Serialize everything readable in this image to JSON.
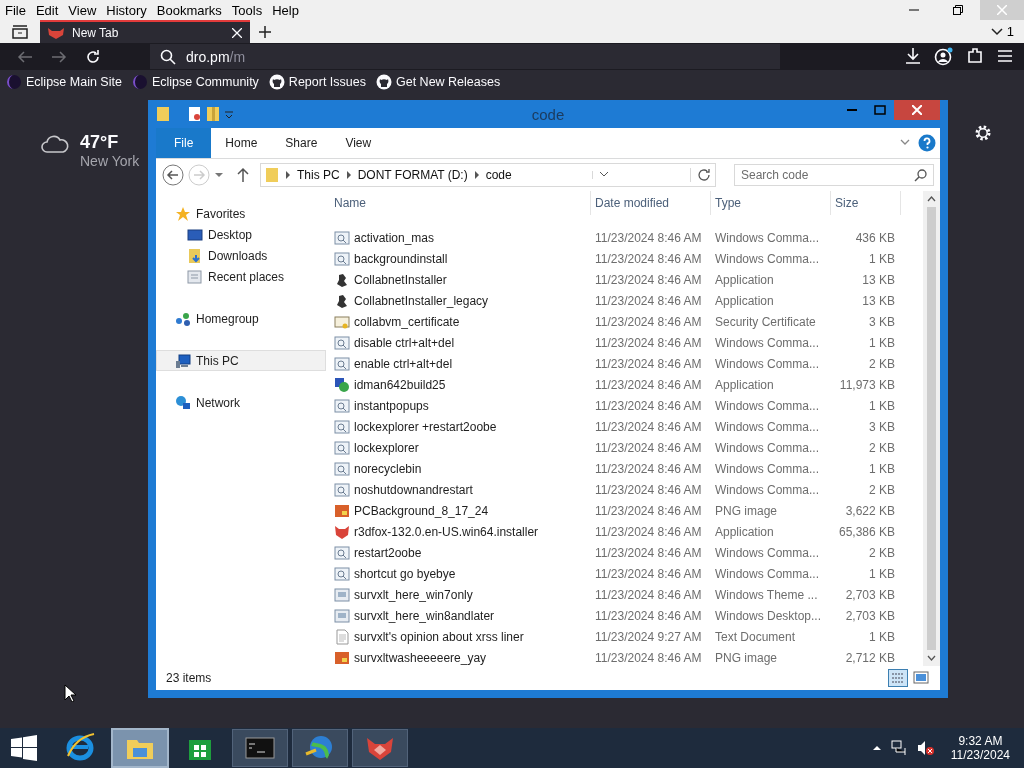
{
  "browser": {
    "menu": [
      "File",
      "Edit",
      "View",
      "History",
      "Bookmarks",
      "Tools",
      "Help"
    ],
    "tabs": [
      {
        "title": "New Tab",
        "selected": true
      }
    ],
    "window_count": "1",
    "url": {
      "host": "dro.pm",
      "path": "/m"
    },
    "bookmarks": [
      {
        "label": "Eclipse Main Site",
        "kind": "eclipse"
      },
      {
        "label": "Eclipse Community",
        "kind": "eclipse"
      },
      {
        "label": "Report Issues",
        "kind": "github"
      },
      {
        "label": "Get New Releases",
        "kind": "github"
      }
    ]
  },
  "weather": {
    "temperature": "47°F",
    "city": "New York"
  },
  "explorer": {
    "title": "code",
    "ribbon_tabs": [
      {
        "label": "File",
        "kind": "menu"
      },
      {
        "label": "Home",
        "kind": "tab"
      },
      {
        "label": "Share",
        "kind": "tab"
      },
      {
        "label": "View",
        "kind": "tab"
      }
    ],
    "breadcrumb": [
      "This PC",
      "DONT FORMAT (D:)",
      "code"
    ],
    "search": {
      "placeholder": "Search code"
    },
    "nav": [
      {
        "label": "Favorites",
        "kind": "star",
        "selected": false,
        "children": [
          {
            "label": "Desktop",
            "kind": "desktop",
            "selected": false
          },
          {
            "label": "Downloads",
            "kind": "downloads",
            "selected": false
          },
          {
            "label": "Recent places",
            "kind": "recent",
            "selected": false
          }
        ]
      },
      {
        "label": "Homegroup",
        "kind": "homegroup",
        "selected": false
      },
      {
        "label": "This PC",
        "kind": "pc",
        "selected": true
      },
      {
        "label": "Network",
        "kind": "network",
        "selected": false
      }
    ],
    "columns": [
      "Name",
      "Date modified",
      "Type",
      "Size"
    ],
    "rows": [
      {
        "name": "activation_mas",
        "date": "11/23/2024 8:46 AM",
        "type": "Windows Comma...",
        "size": "436 KB",
        "kind": "script"
      },
      {
        "name": "backgroundinstall",
        "date": "11/23/2024 8:46 AM",
        "type": "Windows Comma...",
        "size": "1 KB",
        "kind": "script"
      },
      {
        "name": "CollabnetInstaller",
        "date": "11/23/2024 8:46 AM",
        "type": "Application",
        "size": "13 KB",
        "kind": "app"
      },
      {
        "name": "CollabnetInstaller_legacy",
        "date": "11/23/2024 8:46 AM",
        "type": "Application",
        "size": "13 KB",
        "kind": "app"
      },
      {
        "name": "collabvm_certificate",
        "date": "11/23/2024 8:46 AM",
        "type": "Security Certificate",
        "size": "3 KB",
        "kind": "certificate"
      },
      {
        "name": "disable ctrl+alt+del",
        "date": "11/23/2024 8:46 AM",
        "type": "Windows Comma...",
        "size": "1 KB",
        "kind": "script"
      },
      {
        "name": "enable ctrl+alt+del",
        "date": "11/23/2024 8:46 AM",
        "type": "Windows Comma...",
        "size": "2 KB",
        "kind": "script"
      },
      {
        "name": "idman642build25",
        "date": "11/23/2024 8:46 AM",
        "type": "Application",
        "size": "11,973 KB",
        "kind": "globe"
      },
      {
        "name": "instantpopups",
        "date": "11/23/2024 8:46 AM",
        "type": "Windows Comma...",
        "size": "1 KB",
        "kind": "script"
      },
      {
        "name": "lockexplorer +restart2oobe",
        "date": "11/23/2024 8:46 AM",
        "type": "Windows Comma...",
        "size": "3 KB",
        "kind": "script"
      },
      {
        "name": "lockexplorer",
        "date": "11/23/2024 8:46 AM",
        "type": "Windows Comma...",
        "size": "2 KB",
        "kind": "script"
      },
      {
        "name": "norecyclebin",
        "date": "11/23/2024 8:46 AM",
        "type": "Windows Comma...",
        "size": "1 KB",
        "kind": "script"
      },
      {
        "name": "noshutdownandrestart",
        "date": "11/23/2024 8:46 AM",
        "type": "Windows Comma...",
        "size": "2 KB",
        "kind": "script"
      },
      {
        "name": "PCBackground_8_17_24",
        "date": "11/23/2024 8:46 AM",
        "type": "PNG image",
        "size": "3,622 KB",
        "kind": "image"
      },
      {
        "name": "r3dfox-132.0.en-US.win64.installer",
        "date": "11/23/2024 8:46 AM",
        "type": "Application",
        "size": "65,386 KB",
        "kind": "fox"
      },
      {
        "name": "restart2oobe",
        "date": "11/23/2024 8:46 AM",
        "type": "Windows Comma...",
        "size": "2 KB",
        "kind": "script"
      },
      {
        "name": "shortcut go byebye",
        "date": "11/23/2024 8:46 AM",
        "type": "Windows Comma...",
        "size": "1 KB",
        "kind": "script"
      },
      {
        "name": "survxlt_here_win7only",
        "date": "11/23/2024 8:46 AM",
        "type": "Windows Theme ...",
        "size": "2,703 KB",
        "kind": "theme"
      },
      {
        "name": "survxlt_here_win8andlater",
        "date": "11/23/2024 8:46 AM",
        "type": "Windows Desktop...",
        "size": "2,703 KB",
        "kind": "theme"
      },
      {
        "name": "survxlt's opinion about xrss liner",
        "date": "11/23/2024 9:27 AM",
        "type": "Text Document",
        "size": "1 KB",
        "kind": "text"
      },
      {
        "name": "survxltwasheeeeere_yay",
        "date": "11/23/2024 8:46 AM",
        "type": "PNG image",
        "size": "2,712 KB",
        "kind": "image"
      }
    ],
    "status": "23 items"
  },
  "taskbar": {
    "apps": [
      {
        "kind": "ie",
        "running": false,
        "selected": false
      },
      {
        "kind": "folder",
        "running": true,
        "selected": true
      },
      {
        "kind": "store",
        "running": false,
        "selected": false
      },
      {
        "kind": "cmd",
        "running": true,
        "selected": false
      },
      {
        "kind": "globe",
        "running": true,
        "selected": false
      },
      {
        "kind": "fox",
        "running": true,
        "selected": false
      }
    ],
    "time": "9:32 AM",
    "date": "11/23/2024"
  }
}
